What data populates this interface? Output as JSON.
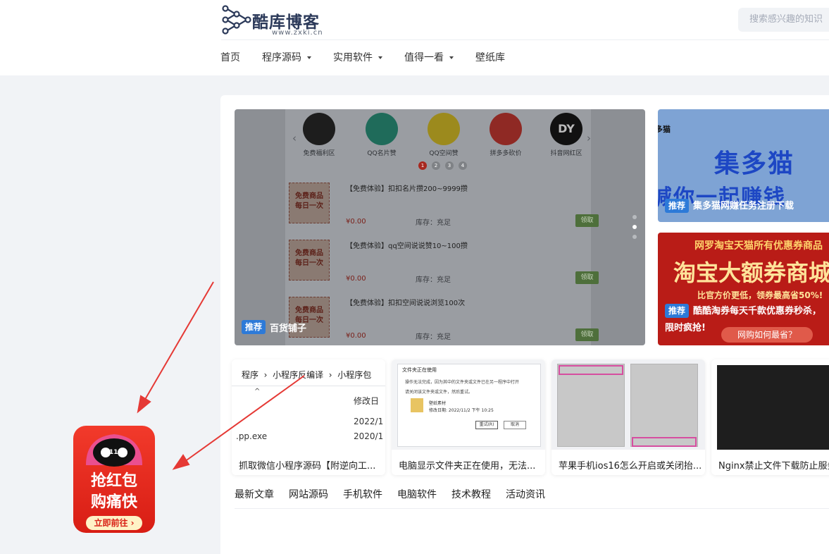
{
  "header": {
    "logo_title": "酷库博客",
    "logo_url_text": "www.zxki.cn",
    "search_placeholder": "搜索感兴趣的知识"
  },
  "nav": [
    {
      "label": "首页",
      "dropdown": false
    },
    {
      "label": "程序源码",
      "dropdown": true
    },
    {
      "label": "实用软件",
      "dropdown": true
    },
    {
      "label": "值得一看",
      "dropdown": true
    },
    {
      "label": "壁纸库",
      "dropdown": false
    }
  ],
  "carousel": {
    "badge": "推荐",
    "caption": "百货铺子",
    "icons": [
      {
        "label": "免费福利区",
        "text": "福利\n暴到",
        "color": "#1d1d1d"
      },
      {
        "label": "QQ名片赞",
        "text": "👍",
        "color": "#1f6b5a"
      },
      {
        "label": "QQ空间赞",
        "text": "☆",
        "color": "#9c8a1d"
      },
      {
        "label": "拼多多砍价",
        "text": "拼",
        "color": "#8f2924"
      },
      {
        "label": "抖音网红区",
        "text": "DY",
        "color": "#111"
      }
    ],
    "pages": [
      "1",
      "2",
      "3",
      "4"
    ],
    "products": [
      {
        "title": "【免费体验】扣扣名片攒200~9999攒",
        "price": "¥0.00",
        "stock": "库存：充足",
        "button": "领取",
        "img_text": "免费商品\n每日一次"
      },
      {
        "title": "【免费体验】qq空间说说赞10~100攒",
        "price": "¥0.00",
        "stock": "库存：充足",
        "button": "领取",
        "img_text": "免费商品\n每日一次"
      },
      {
        "title": "【免费体验】扣扣空间说说浏览100次",
        "price": "¥0.00",
        "stock": "库存：充足",
        "button": "领取",
        "img_text": "免费商品\n每日一次"
      }
    ]
  },
  "banners": [
    {
      "badge": "推荐",
      "caption": "集多猫网赚任务注册下载",
      "art_text": "集多猫",
      "art_sub": "喊你一起赚钱",
      "corner": "多猫"
    },
    {
      "badge": "推荐",
      "caption": "酷酷淘券每天千款优惠券秒杀，",
      "caption2": "限时疯抢!",
      "art_top": "网罗淘宝天猫所有优惠券商品",
      "art_text": "淘宝大额券商城",
      "art_sub": "比官方价更低，领券最高省50%!",
      "art_btn": "网购如何最省？"
    }
  ],
  "thumbs": [
    {
      "title": "抓取微信小程序源码【附逆向工...",
      "crumbs": [
        "程序",
        "小程序反编译",
        "小程序包"
      ],
      "lines": [
        "修改日",
        "2022/1",
        "2020/1",
        ".pp.exe"
      ]
    },
    {
      "title": "电脑显示文件夹正在使用，无法...",
      "dialog_title": "文件夹正在使用",
      "dialog_line1": "操作无法完成，因为其中的文件夹或文件已在另一程序中打开",
      "dialog_line2": "请关闭该文件夹或文件，然后重试。",
      "folder_name": "壁纸素材",
      "folder_date": "修改日期: 2022/11/2 下午 10:25",
      "btn_retry": "重试(R)",
      "btn_cancel": "取消"
    },
    {
      "title": "苹果手机ios16怎么开启或关闭抬..."
    },
    {
      "title": "Nginx禁止文件下载防止服务..."
    }
  ],
  "tabs": [
    "最新文章",
    "网站源码",
    "手机软件",
    "电脑软件",
    "技术教程",
    "活动资讯"
  ],
  "float_ad": {
    "brand": "双11",
    "line1": "抢红包",
    "line2": "购痛快",
    "button": "立即前往 ›"
  },
  "colors": {
    "accent": "#2d7ad8",
    "ad_red": "#e8261c",
    "annotation": "#e53935"
  }
}
